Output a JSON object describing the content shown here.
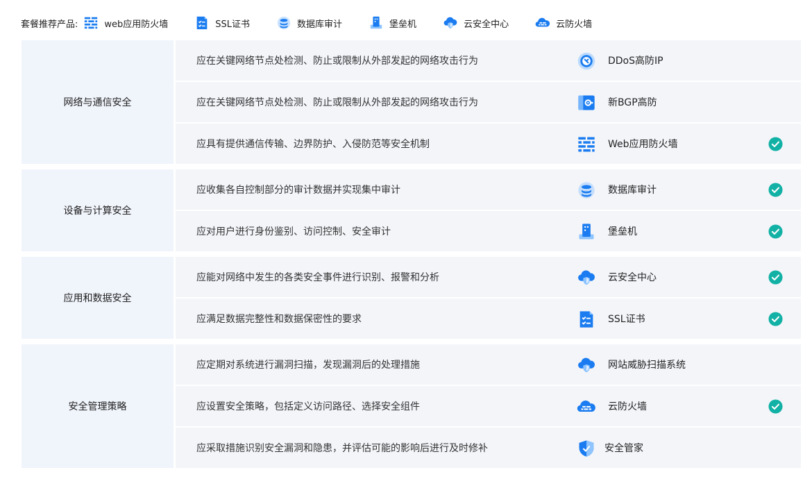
{
  "top": {
    "label": "套餐推荐产品:",
    "products": [
      {
        "name": "web应用防火墙",
        "icon": "firewall-icon"
      },
      {
        "name": "SSL证书",
        "icon": "certificate-icon"
      },
      {
        "name": "数据库审计",
        "icon": "database-audit-icon"
      },
      {
        "name": "堡垒机",
        "icon": "bastion-host-icon"
      },
      {
        "name": "云安全中心",
        "icon": "cloud-security-icon"
      },
      {
        "name": "云防火墙",
        "icon": "cloud-firewall-icon"
      }
    ]
  },
  "sections": [
    {
      "category": "网络与通信安全",
      "rows": [
        {
          "requirement": "应在关键网络节点处检测、防止或限制从外部发起的网络攻击行为",
          "product": "DDoS高防IP",
          "icon": "ddos-ip-icon",
          "checked": false
        },
        {
          "requirement": "应在关键网络节点处检测、防止或限制从外部发起的网络攻击行为",
          "product": "新BGP高防",
          "icon": "bgp-defense-icon",
          "checked": false
        },
        {
          "requirement": "应具有提供通信传输、边界防护、入侵防范等安全机制",
          "product": "Web应用防火墙",
          "icon": "firewall-icon",
          "checked": true
        }
      ]
    },
    {
      "category": "设备与计算安全",
      "rows": [
        {
          "requirement": "应收集各自控制部分的审计数据并实现集中审计",
          "product": "数据库审计",
          "icon": "database-audit-icon",
          "checked": true
        },
        {
          "requirement": "应对用户进行身份鉴别、访问控制、安全审计",
          "product": "堡垒机",
          "icon": "bastion-host-icon",
          "checked": true
        }
      ]
    },
    {
      "category": "应用和数据安全",
      "rows": [
        {
          "requirement": "应能对网络中发生的各类安全事件进行识别、报警和分析",
          "product": "云安全中心",
          "icon": "cloud-security-icon",
          "checked": true
        },
        {
          "requirement": "应满足数据完整性和数据保密性的要求",
          "product": "SSL证书",
          "icon": "certificate-icon",
          "checked": true
        }
      ]
    },
    {
      "category": "安全管理策略",
      "rows": [
        {
          "requirement": "应定期对系统进行漏洞扫描，发现漏洞后的处理措施",
          "product": "网站威胁扫描系统",
          "icon": "cloud-security-icon",
          "checked": false
        },
        {
          "requirement": "应设置安全策略，包括定义访问路径、选择安全组件",
          "product": "云防火墙",
          "icon": "cloud-firewall-icon",
          "checked": true
        },
        {
          "requirement": "应采取措施识别安全漏洞和隐患，并评估可能的影响后进行及时修补",
          "product": "安全管家",
          "icon": "shield-icon",
          "checked": false
        }
      ]
    }
  ],
  "colors": {
    "accent": "#1a7cf0",
    "check": "#12b1a5",
    "category_bg": "#f0f4fb",
    "row_bg": "#f3f5f9"
  }
}
